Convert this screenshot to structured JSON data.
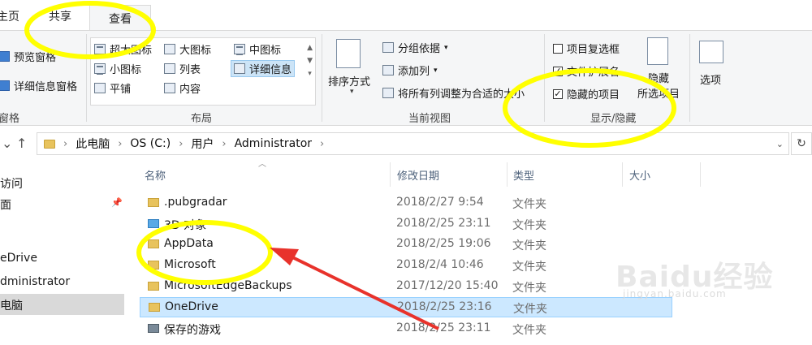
{
  "tabs": [
    {
      "label": "主页"
    },
    {
      "label": "共享"
    },
    {
      "label": "查看"
    }
  ],
  "ribbon": {
    "panes": {
      "preview_pane": "预览窗格",
      "details_pane": "详细信息窗格",
      "group_label": "窗格"
    },
    "layout": {
      "options": [
        "超大图标",
        "大图标",
        "中图标",
        "小图标",
        "列表",
        "详细信息",
        "平铺",
        "内容"
      ],
      "selected": "详细信息",
      "group_label": "布局"
    },
    "current_view": {
      "sort_by": "排序方式",
      "group_by": "分组依据",
      "add_column": "添加列",
      "fit_columns": "将所有列调整为合适的大小",
      "group_label": "当前视图"
    },
    "show_hide": {
      "item_checkboxes": {
        "label": "项目复选框",
        "checked": false
      },
      "file_extensions": {
        "label": "文件扩展名",
        "checked": true
      },
      "hidden_items": {
        "label": "隐藏的项目",
        "checked": true
      },
      "hide_selected": "隐藏\n所选项目",
      "group_label": "显示/隐藏"
    },
    "options": "选项"
  },
  "address": {
    "crumbs": [
      "此电脑",
      "OS (C:)",
      "用户",
      "Administrator"
    ]
  },
  "nav": {
    "items": [
      "访问",
      "面",
      "eDrive",
      "dministrator",
      "电脑"
    ],
    "selected_index": 4
  },
  "columns": {
    "name": "名称",
    "date": "修改日期",
    "type": "类型",
    "size": "大小"
  },
  "files": [
    {
      "name": ".pubgradar",
      "date": "2018/2/27 9:54",
      "type": "文件夹",
      "icon": "folder"
    },
    {
      "name": "3D 对象",
      "date": "2018/2/25 23:11",
      "type": "文件夹",
      "icon": "3d-objects"
    },
    {
      "name": "AppData",
      "date": "2018/2/25 19:06",
      "type": "文件夹",
      "icon": "folder"
    },
    {
      "name": "Microsoft",
      "date": "2018/2/4 10:46",
      "type": "文件夹",
      "icon": "folder"
    },
    {
      "name": "MicrosoftEdgeBackups",
      "date": "2017/12/20 15:40",
      "type": "文件夹",
      "icon": "folder"
    },
    {
      "name": "OneDrive",
      "date": "2018/2/25 23:16",
      "type": "文件夹",
      "icon": "folder"
    },
    {
      "name": "保存的游戏",
      "date": "2018/2/25 23:11",
      "type": "文件夹",
      "icon": "saved-games"
    }
  ],
  "selected_file": "OneDrive",
  "watermark": {
    "text": "Baidu经验",
    "sub": "jingyan.baidu.com"
  },
  "colors": {
    "highlight": "#ffff00",
    "arrow": "#e8322b",
    "selection": "#cce8ff"
  }
}
